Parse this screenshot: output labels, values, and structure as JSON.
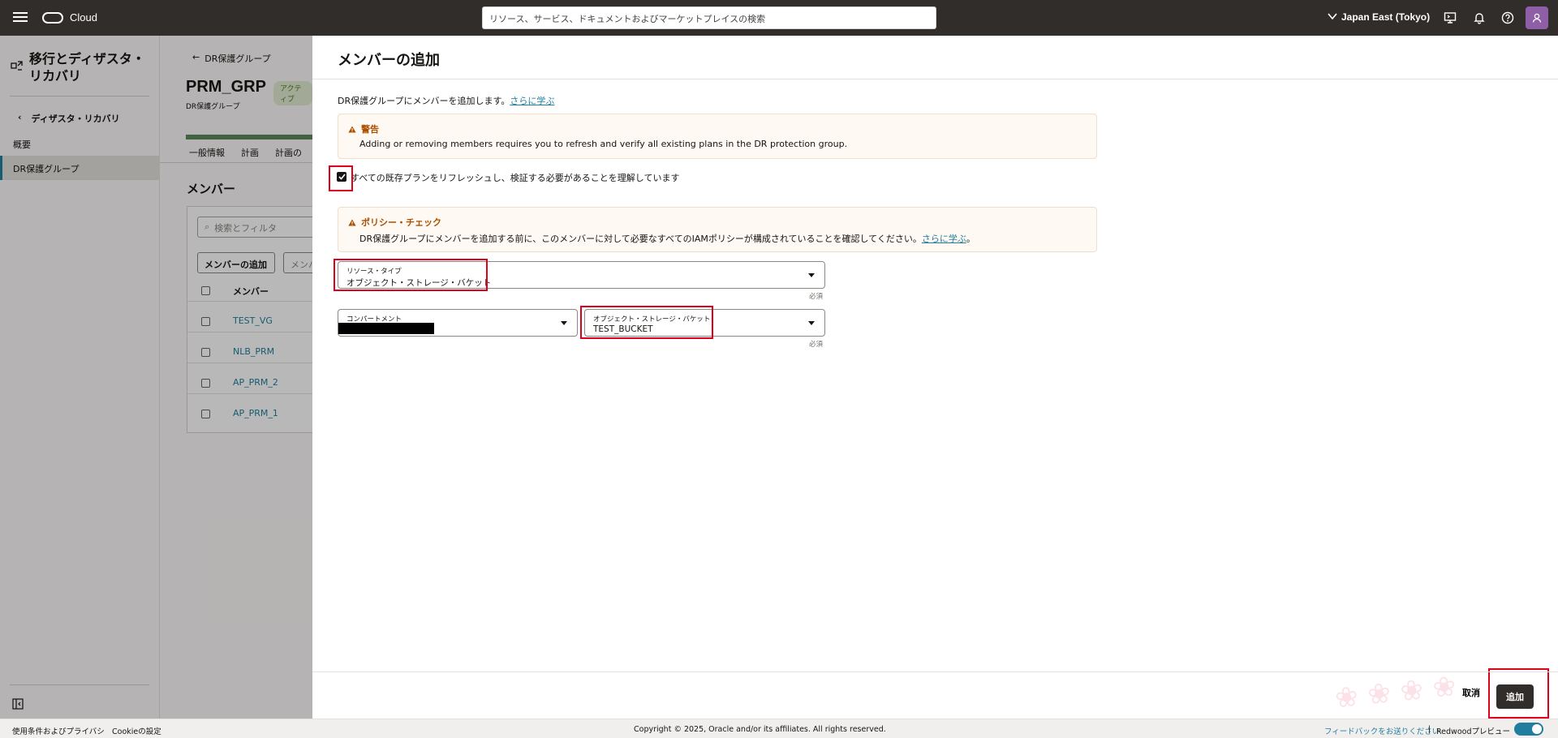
{
  "topbar": {
    "brand": "Cloud",
    "search_placeholder": "リソース、サービス、ドキュメントおよびマーケットプレイスの検索",
    "region": "Japan East (Tokyo)"
  },
  "leftnav": {
    "title": "移行とディザスタ・リカバリ",
    "back_label": "ディザスタ・リカバリ",
    "items": [
      "概要",
      "DR保護グループ"
    ],
    "active_index": 1
  },
  "background": {
    "back_link": "DR保護グループ",
    "title": "PRM_GRP",
    "badge": "アクティブ",
    "subtitle": "DR保護グループ",
    "tabs": [
      "一般情報",
      "計画",
      "計画の"
    ],
    "section_title": "メンバー",
    "search_placeholder": "検索とフィルタ",
    "add_member_button": "メンバーの追加",
    "second_button": "メンバ",
    "column_header": "メンバー",
    "rows": [
      "TEST_VG",
      "NLB_PRM",
      "AP_PRM_2",
      "AP_PRM_1"
    ]
  },
  "panel": {
    "title": "メンバーの追加",
    "intro": "DR保護グループにメンバーを追加します。",
    "learn_more": "さらに学ぶ",
    "warning": {
      "title": "警告",
      "text": "Adding or removing members requires you to refresh and verify all existing plans in the DR protection group."
    },
    "acknowledge_label": "すべての既存プランをリフレッシュし、検証する必要があることを理解しています",
    "acknowledge_checked": true,
    "policy": {
      "title": "ポリシー・チェック",
      "text": "DR保護グループにメンバーを追加する前に、このメンバーに対して必要なすべてのIAMポリシーが構成されていることを確認してください。",
      "link": "さらに学ぶ",
      "suffix": "。"
    },
    "resource_type": {
      "label": "リソース・タイプ",
      "value": "オブジェクト・ストレージ・バケット"
    },
    "compartment": {
      "label": "コンパートメント",
      "value": ""
    },
    "bucket": {
      "label": "オブジェクト・ストレージ・バケット",
      "value": "TEST_BUCKET"
    },
    "required_label": "必須",
    "cancel_label": "取消",
    "add_label": "追加"
  },
  "footer": {
    "terms": "使用条件およびプライバシ",
    "cookies": "Cookieの設定",
    "copyright": "Copyright © 2025, Oracle and/or its affiliates. All rights reserved.",
    "feedback": "フィードバックをお送りください",
    "separator": "|",
    "preview": "Redwoodプレビュー"
  },
  "colors": {
    "topbar": "#312d2a",
    "link": "#227e9e",
    "highlight": "#e0001b",
    "warning_bg": "#fef9f2"
  }
}
